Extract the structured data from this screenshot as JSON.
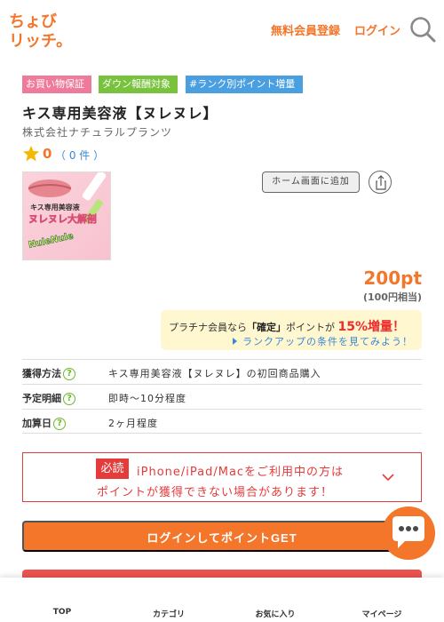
{
  "header": {
    "logo_text": "ちょびリッチ。",
    "register_label": "無料会員登録",
    "login_label": "ログイン"
  },
  "badges": [
    "お買い物保証",
    "ダウン報酬対象",
    "#ランク別ポイント増量"
  ],
  "product": {
    "title": "キス専用美容液【ヌレヌレ】",
    "company": "株式会社ナチュラルプランツ",
    "rating_score": "0",
    "rating_count": "（ 0 件 ）",
    "image_caption_1": "キス専用美容液",
    "image_caption_2": "ヌレヌレ大解剖",
    "image_caption_3": "NuleNule"
  },
  "actions": {
    "home_screen_label": "ホーム画面に追加"
  },
  "reward": {
    "points": "200pt",
    "yen": "(100円相当)",
    "platinum_prefix": "プラチナ会員なら",
    "platinum_bold": "「確定」",
    "platinum_suffix": "ポイントが",
    "platinum_pct": "15%増量！",
    "platinum_link": "ランクアップの条件を見てみよう！"
  },
  "info": [
    {
      "key": "獲得方法",
      "value": "キス専用美容液【ヌレヌレ】の初回商品購入"
    },
    {
      "key": "予定明細",
      "value": "即時〜10分程度"
    },
    {
      "key": "加算日",
      "value": "2ヶ月程度"
    }
  ],
  "notice": {
    "required_label": "必読",
    "line1": "iPhone/iPad/Macをご利用中の方は",
    "line2": "ポイントが獲得できない場合があります！"
  },
  "cta": {
    "login_get_label": "ログインしてポイントGET"
  },
  "bottom_nav": [
    "TOP",
    "カテゴリ",
    "お気に入り",
    "マイページ"
  ],
  "colors": {
    "accent": "#f3762a",
    "link": "#3a86d6",
    "alert": "#e53b3b"
  }
}
